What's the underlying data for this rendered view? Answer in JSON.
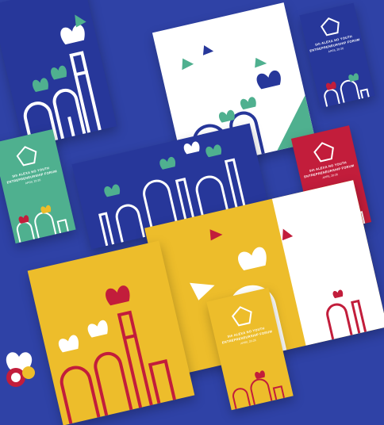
{
  "scene": {
    "description_free": true,
    "colors": {
      "background": "#2f42a6",
      "navy": "#27379a",
      "white": "#ffffff",
      "teal": "#4fb08f",
      "yellow": "#edbd2b",
      "crimson": "#c21d3b"
    }
  },
  "brand": {
    "line1": "5th ALEXA NO YOUTH",
    "line2": "ENTREPRENEURSHIP FORUM",
    "date": "APRIL 20-26"
  },
  "icons": [
    "tulip-icon",
    "mosque-dome-icon",
    "minaret-icon",
    "logo-seal-icon",
    "brand-mark-icon"
  ]
}
